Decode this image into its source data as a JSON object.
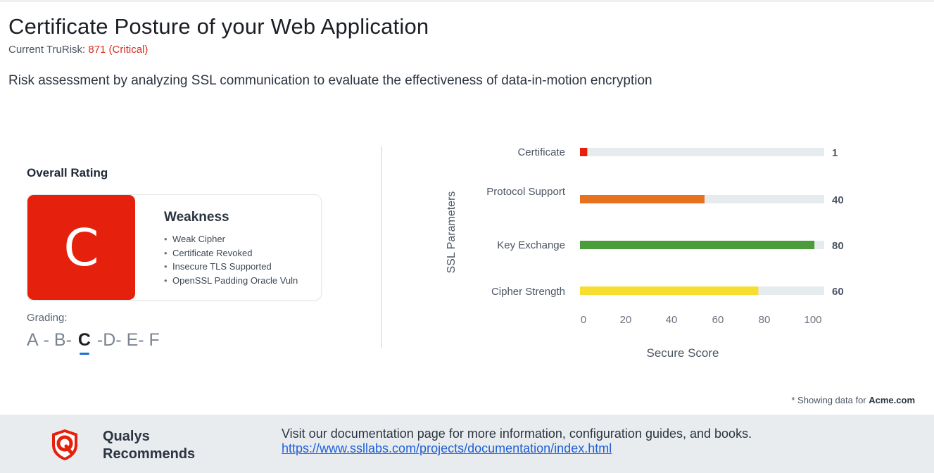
{
  "header": {
    "title": "Certificate Posture of your Web Application",
    "trurisk_label": "Current TruRisk: ",
    "trurisk_value": "871 (Critical)",
    "description": "Risk assessment by analyzing SSL communication to evaluate the effectiveness of data-in-motion encryption"
  },
  "rating": {
    "label": "Overall Rating",
    "grade": "C",
    "grade_color": "#e5200c",
    "weakness_title": "Weakness",
    "weaknesses": [
      "Weak Cipher",
      "Certificate Revoked",
      "Insecure TLS Supported",
      "OpenSSL Padding Oracle Vuln"
    ]
  },
  "grading": {
    "label": "Grading:",
    "scale": [
      "A",
      " - ",
      "B",
      "- ",
      "C",
      " -",
      "D",
      "- ",
      "E",
      "- ",
      "F"
    ],
    "current": "C"
  },
  "chart_data": {
    "type": "bar",
    "orientation": "horizontal",
    "categories": [
      "Certificate",
      "Protocol Support",
      "Key Exchange",
      "Cipher Strength"
    ],
    "values": [
      1,
      40,
      80,
      60
    ],
    "bar_fill": [
      3,
      51,
      96,
      73
    ],
    "colors": [
      "#e5200c",
      "#e8711f",
      "#4a9d3a",
      "#f6dd2f"
    ],
    "track_color": "#e6ebee",
    "xlabel": "Secure Score",
    "ylabel": "SSL Parameters",
    "xticks": [
      0,
      20,
      40,
      60,
      80,
      100
    ],
    "xlim": [
      0,
      100
    ],
    "grid": false
  },
  "footer": {
    "note_prefix": "* Showing data for ",
    "note_domain": "Acme.com",
    "brand_line1": "Qualys",
    "brand_line2": "Recommends",
    "text": "Visit our documentation page for more information, configuration guides, and books. ",
    "link": "https://www.ssllabs.com/projects/documentation/index.html",
    "brand_color": "#e5200c"
  }
}
